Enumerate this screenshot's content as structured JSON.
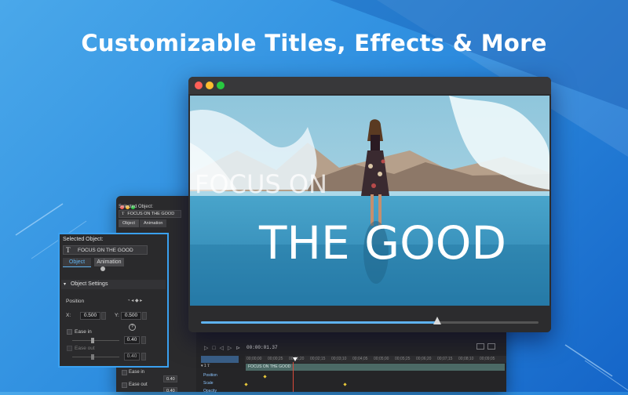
{
  "headline": "Customizable Titles, Effects & More",
  "window": {
    "traffic_lights": [
      "#ff5f57",
      "#febc2e",
      "#28c840"
    ],
    "overlay_text": {
      "line1": "FOCUS ON",
      "line2": "THE GOOD"
    },
    "playback_progress": 0.7
  },
  "editor": {
    "selected_object_label": "Selected Object:",
    "object_text": "FOCUS ON THE GOOD",
    "tabs": [
      "Object",
      "Animation"
    ],
    "ease_in_label": "Ease in",
    "ease_out_label": "Ease out",
    "ease_values": [
      "0.40",
      "0.40"
    ]
  },
  "timeline": {
    "timecode": "00:00:01.37",
    "ruler_ticks": [
      "00;00;00",
      "00;00;25",
      "00;01;20",
      "00;02;15",
      "00;03;10",
      "00;04;05",
      "00;05;00",
      "00;05;25",
      "00;06;20",
      "00;07;15",
      "00;08;10",
      "00;09;05"
    ],
    "track_number": "1",
    "clip_label": "FOCUS ON THE GOOD",
    "properties": [
      "Position",
      "Scale",
      "Opacity"
    ]
  },
  "inspector": {
    "selected_object_label": "Selected Object:",
    "text_icon": "T",
    "object_text": "FOCUS ON THE GOOD",
    "tabs": {
      "object": "Object",
      "animation": "Animation"
    },
    "section_title": "Object Settings",
    "position_label": "Position",
    "x_label": "X:",
    "x_value": "0.500",
    "y_label": "Y:",
    "y_value": "0.500",
    "ease_in_label": "Ease in",
    "ease_in_value": "0.40",
    "ease_out_label": "Ease out",
    "ease_out_value": "0.40",
    "help_icon": "?"
  },
  "colors": {
    "accent": "#3aa0f0",
    "bg_blue": "#2f8fe0"
  }
}
